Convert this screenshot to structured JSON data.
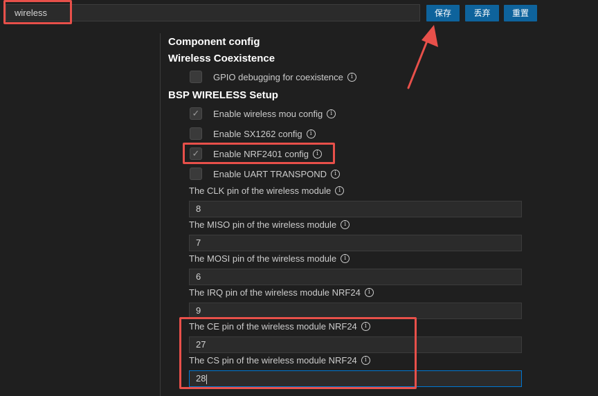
{
  "search": {
    "value": "wireless"
  },
  "buttons": {
    "save": "保存",
    "discard": "丢弃",
    "reset": "重置"
  },
  "headings": {
    "component_config": "Component config",
    "wireless_coexistence": "Wireless Coexistence",
    "bsp_wireless_setup": "BSP WIRELESS Setup"
  },
  "checkboxes": [
    {
      "label": "GPIO debugging for coexistence",
      "checked": false
    },
    {
      "label": "Enable wireless mou config",
      "checked": true
    },
    {
      "label": "Enable SX1262 config",
      "checked": false
    },
    {
      "label": "Enable NRF2401 config",
      "checked": true
    },
    {
      "label": "Enable UART TRANSPOND",
      "checked": false
    }
  ],
  "fields": [
    {
      "label": "The CLK pin of the wireless module",
      "value": "8"
    },
    {
      "label": "The MISO pin of the wireless module",
      "value": "7"
    },
    {
      "label": "The MOSI pin of the wireless module",
      "value": "6"
    },
    {
      "label": "The IRQ pin of the wireless module NRF24",
      "value": "9"
    },
    {
      "label": "The CE pin of the wireless module NRF24",
      "value": "27"
    },
    {
      "label": "The CS pin of the wireless module NRF24",
      "value": "28"
    }
  ],
  "icons": {
    "info": "info-icon",
    "check": "check-icon",
    "arrow": "annotation-arrow"
  },
  "colors": {
    "accent_button": "#0e639c",
    "annotation_red": "#e8504a",
    "focus_border": "#0078d4"
  }
}
